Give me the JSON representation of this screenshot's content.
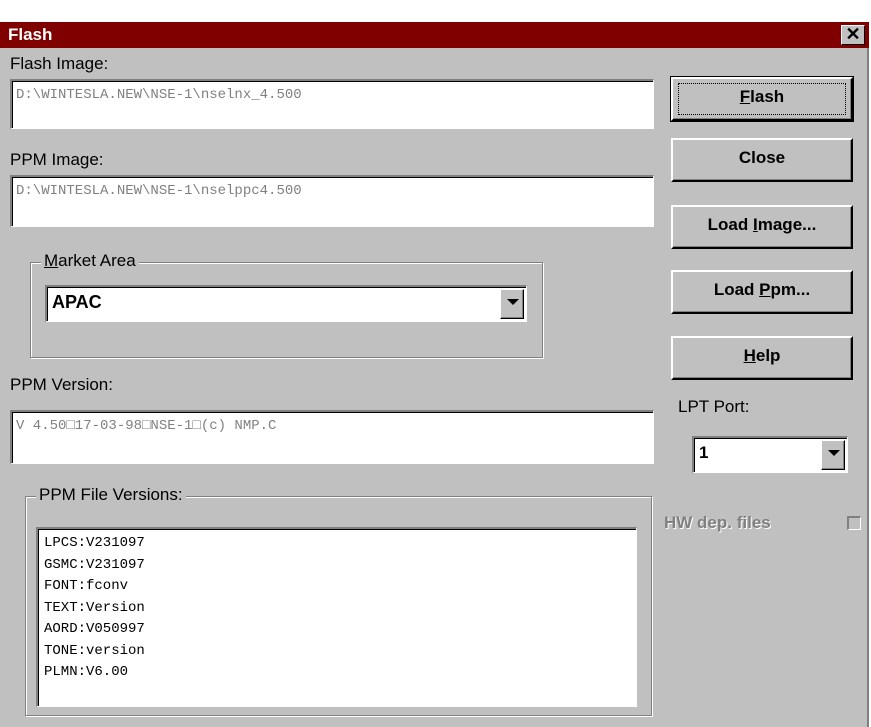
{
  "window": {
    "title": "Flash",
    "close_glyph": "✕"
  },
  "labels": {
    "flash_image": "Flash Image:",
    "ppm_image": "PPM Image:",
    "ppm_version": "PPM Version:",
    "lpt_port": "LPT Port:"
  },
  "fields": {
    "flash_image_value": "D:\\WINTESLA.NEW\\NSE-1\\nselnx_4.500",
    "ppm_image_value": "D:\\WINTESLA.NEW\\NSE-1\\nselppc4.500",
    "ppm_version_value": "V  4.50□17-03-98□NSE-1□(c) NMP.C"
  },
  "market_area": {
    "group_title_prefix": "",
    "group_title_mnemonic": "M",
    "group_title_rest": "arket Area",
    "selected": "APAC"
  },
  "ppm_file_versions": {
    "group_title": "PPM File Versions:",
    "items": [
      "LPCS:V231097",
      "GSMC:V231097",
      "FONT:fconv",
      "TEXT:Version",
      "AORD:V050997",
      "TONE:version",
      "PLMN:V6.00"
    ]
  },
  "buttons": {
    "flash": {
      "pre": "",
      "mn": "F",
      "post": "lash"
    },
    "close": {
      "pre": "Close",
      "mn": "",
      "post": ""
    },
    "load_image": {
      "pre": "Load ",
      "mn": "I",
      "post": "mage..."
    },
    "load_ppm": {
      "pre": "Load ",
      "mn": "P",
      "post": "pm..."
    },
    "help": {
      "pre": "",
      "mn": "H",
      "post": "elp"
    }
  },
  "lpt_port": {
    "selected": "1"
  },
  "hw_dep": {
    "label": "HW dep. files",
    "checked": false,
    "enabled": false
  },
  "colors": {
    "titlebar": "#800000",
    "dialog_bg": "#c0c0c0"
  }
}
